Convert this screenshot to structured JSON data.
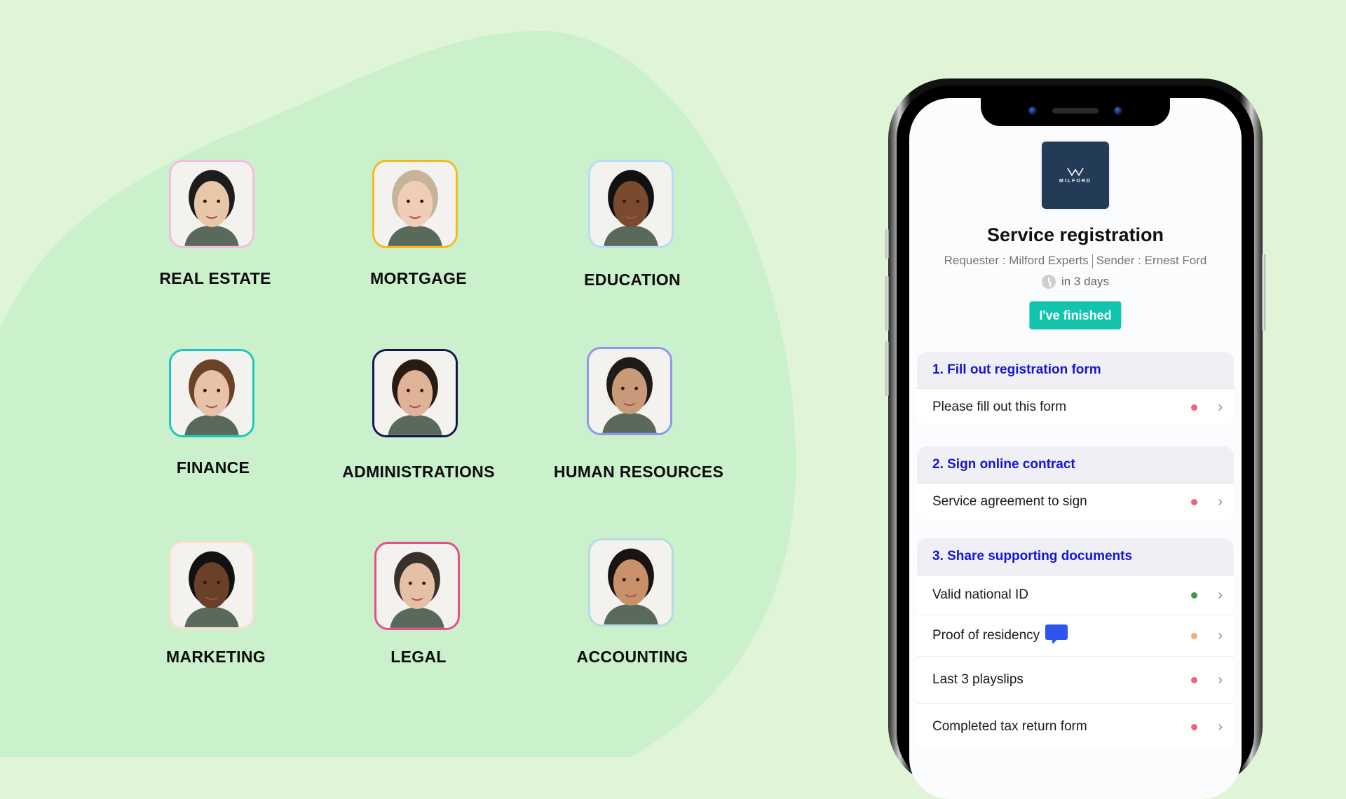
{
  "colors": {
    "background": "#e0f5d8",
    "blob": "#cbf0cc",
    "accent_button": "#12c4ae",
    "section_heading": "#1414d6",
    "logo_bg": "#243b57",
    "status_red": "#e8667c",
    "status_green": "#3a9a48",
    "status_orange": "#f9a882",
    "comment_blue": "#2d56ef"
  },
  "departments": [
    {
      "label": "REAL ESTATE",
      "border": "#f7bcdc",
      "icon": "person-photo"
    },
    {
      "label": "MORTGAGE",
      "border": "#f6b81c",
      "icon": "person-photo"
    },
    {
      "label": "EDUCATION",
      "border": "#b6ddf8",
      "icon": "person-photo"
    },
    {
      "label": "FINANCE",
      "border": "#1cc9b6",
      "icon": "person-photo"
    },
    {
      "label": "ADMINISTRATIONS",
      "border": "#141452",
      "icon": "person-photo"
    },
    {
      "label": "HUMAN RESOURCES",
      "border": "#8a98f2",
      "icon": "person-photo"
    },
    {
      "label": "MARKETING",
      "border": "#fcded0",
      "icon": "person-photo"
    },
    {
      "label": "LEGAL",
      "border": "#ea4c86",
      "icon": "person-photo"
    },
    {
      "label": "ACCOUNTING",
      "border": "#b4dbe4",
      "icon": "person-photo"
    }
  ],
  "phone": {
    "logo": {
      "text": "MILFORD",
      "icon": "milford-logo-icon"
    },
    "title": "Service registration",
    "requester": "Requester : Milford Experts",
    "sender": "Sender : Ernest Ford",
    "due": "in 3 days",
    "finish_button": "I've finished",
    "sections": [
      {
        "heading": "1. Fill out registration form",
        "items": [
          {
            "label": "Please fill out this form",
            "status": "red"
          }
        ]
      },
      {
        "heading": "2. Sign online contract",
        "items": [
          {
            "label": "Service agreement to sign",
            "status": "red"
          }
        ]
      },
      {
        "heading": "3. Share supporting documents",
        "items": [
          {
            "label": "Valid national ID",
            "status": "green"
          },
          {
            "label": "Proof of residency",
            "status": "orange",
            "comment": true
          },
          {
            "label": "Last 3 playslips",
            "status": "red"
          },
          {
            "label": "Completed tax return form",
            "status": "red"
          }
        ]
      }
    ]
  }
}
